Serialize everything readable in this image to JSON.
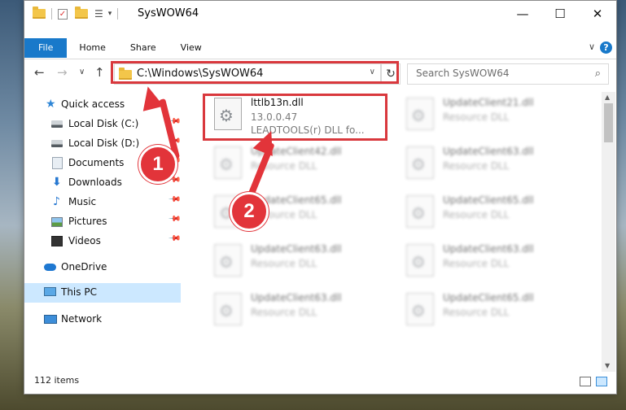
{
  "window": {
    "title": "SysWOW64",
    "minimize": "—",
    "maximize": "☐",
    "close": "✕"
  },
  "ribbon": {
    "tabs": [
      "File",
      "Home",
      "Share",
      "View"
    ],
    "collapse_glyph": "∨",
    "help_glyph": "?"
  },
  "nav_buttons": {
    "back": "←",
    "forward": "→",
    "recent": "∨",
    "up": "↑"
  },
  "address": {
    "path": "C:\\Windows\\SysWOW64",
    "dropdown_glyph": "∨",
    "refresh_glyph": "↻"
  },
  "search": {
    "placeholder": "Search SysWOW64",
    "icon_glyph": "⌕"
  },
  "nav_pane": {
    "items": [
      {
        "label": "Quick access",
        "icon": "star-icon"
      },
      {
        "label": "Local Disk (C:)",
        "icon": "drive-icon",
        "pinned": true
      },
      {
        "label": "Local Disk (D:)",
        "icon": "drive-icon",
        "pinned": true
      },
      {
        "label": "Documents",
        "icon": "documents-icon",
        "pinned": true
      },
      {
        "label": "Downloads",
        "icon": "downloads-icon",
        "pinned": true
      },
      {
        "label": "Music",
        "icon": "music-icon",
        "pinned": true
      },
      {
        "label": "Pictures",
        "icon": "pictures-icon",
        "pinned": true
      },
      {
        "label": "Videos",
        "icon": "videos-icon",
        "pinned": true
      },
      {
        "label": "OneDrive",
        "icon": "cloud-icon"
      },
      {
        "label": "This PC",
        "icon": "computer-icon",
        "selected": true
      },
      {
        "label": "Network",
        "icon": "network-icon"
      }
    ],
    "pin_glyph": "📌"
  },
  "files": [
    {
      "name": "lttlb13n.dll",
      "line1": "13.0.0.47",
      "line2": "LEADTOOLS(r) DLL fo..."
    },
    {
      "name": "UpdateClient21.dll",
      "line1": "Resource DLL"
    },
    {
      "name": "UpdateClient42.dll",
      "line1": "Resource DLL"
    },
    {
      "name": "UpdateClient63.dll",
      "line1": "Resource DLL"
    },
    {
      "name": "UpdateClient65.dll",
      "line1": "Resource DLL"
    },
    {
      "name": "UpdateClient65.dll",
      "line1": "Resource DLL"
    },
    {
      "name": "UpdateClient63.dll",
      "line1": "Resource DLL"
    },
    {
      "name": "UpdateClient63.dll",
      "line1": "Resource DLL"
    },
    {
      "name": "UpdateClient63.dll",
      "line1": "Resource DLL"
    },
    {
      "name": "UpdateClient65.dll",
      "line1": "Resource DLL"
    }
  ],
  "status": {
    "item_count": "112 items"
  },
  "annotations": {
    "badge1": "1",
    "badge2": "2"
  },
  "colors": {
    "accent": "#1979ca",
    "highlight": "#d9383d",
    "selection": "#cce8ff"
  }
}
